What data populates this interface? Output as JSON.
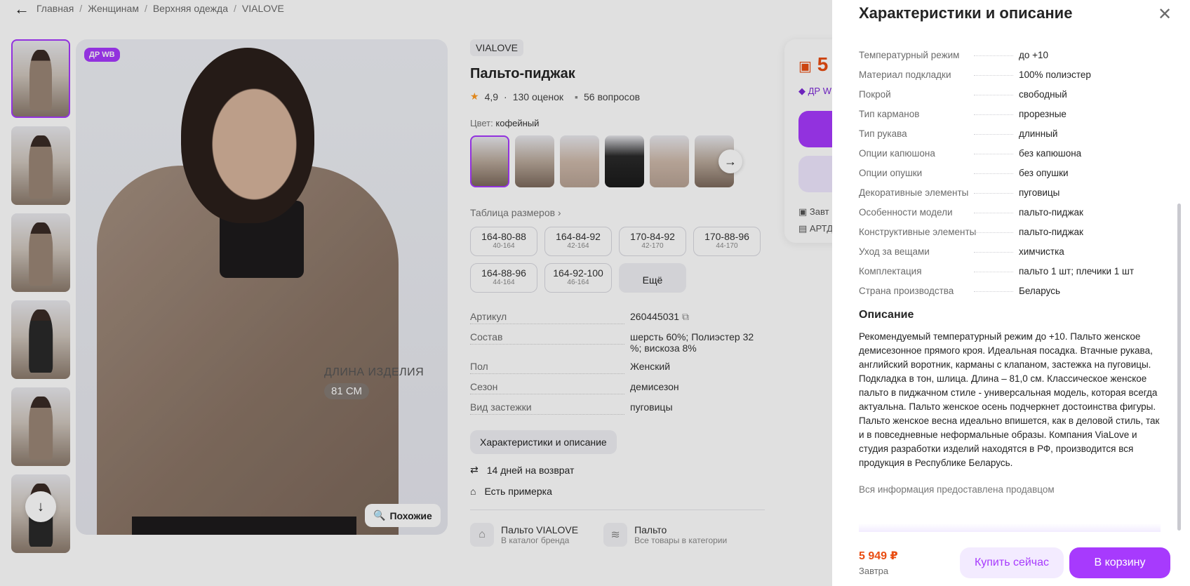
{
  "breadcrumb": {
    "items": [
      "Главная",
      "Женщинам",
      "Верхняя одежда",
      "VIALOVE"
    ],
    "separator": "/"
  },
  "gallery": {
    "badge": "ДР WB",
    "length_label": "ДЛИНА ИЗДЕЛИЯ",
    "length_value": "81 СМ",
    "similar_label": "Похожие"
  },
  "product": {
    "brand": "VIALOVE",
    "title": "Пальто-пиджак",
    "rating": "4,9",
    "rating_sep": "·",
    "reviews": "130 оценок",
    "questions": "56 вопросов",
    "color_label": "Цвет:",
    "color_value": "кофейный",
    "size_table": "Таблица размеров",
    "sizes": [
      {
        "main": "164-80-88",
        "sub": "40-164"
      },
      {
        "main": "164-84-92",
        "sub": "42-164"
      },
      {
        "main": "170-84-92",
        "sub": "42-170"
      },
      {
        "main": "170-88-96",
        "sub": "44-170"
      },
      {
        "main": "164-88-96",
        "sub": "44-164"
      },
      {
        "main": "164-92-100",
        "sub": "46-164"
      }
    ],
    "more_sizes": "Ещё",
    "params": [
      {
        "k": "Артикул",
        "v": "260445031"
      },
      {
        "k": "Состав",
        "v": "шерсть 60%; Полиэстер 32 %; вискоза 8%"
      },
      {
        "k": "Пол",
        "v": "Женский"
      },
      {
        "k": "Сезон",
        "v": "демисезон"
      },
      {
        "k": "Вид застежки",
        "v": "пуговицы"
      }
    ],
    "char_button": "Характеристики и описание",
    "returns": "14 дней на возврат",
    "fitting": "Есть примерка",
    "brand_link": {
      "title": "Пальто VIALOVE",
      "sub": "В каталог бренда"
    },
    "category_link": {
      "title": "Пальто",
      "sub": "Все товары в категории"
    }
  },
  "price_card": {
    "price_partial": "5",
    "tag_partial": "ДР W",
    "delivery_partial": "Завт",
    "pickup_partial": "АРТД"
  },
  "panel": {
    "title": "Характеристики и описание",
    "specs": [
      {
        "k": "Температурный режим",
        "v": "до +10"
      },
      {
        "k": "Материал подкладки",
        "v": "100% полиэстер"
      },
      {
        "k": "Покрой",
        "v": "свободный"
      },
      {
        "k": "Тип карманов",
        "v": "прорезные"
      },
      {
        "k": "Тип рукава",
        "v": "длинный"
      },
      {
        "k": "Опции капюшона",
        "v": "без капюшона"
      },
      {
        "k": "Опции опушки",
        "v": "без опушки"
      },
      {
        "k": "Декоративные элементы",
        "v": "пуговицы"
      },
      {
        "k": "Особенности модели",
        "v": "пальто-пиджак"
      },
      {
        "k": "Конструктивные элементы",
        "v": "пальто-пиджак"
      },
      {
        "k": "Уход за вещами",
        "v": "химчистка"
      },
      {
        "k": "Комплектация",
        "v": "пальто 1 шт; плечики 1 шт"
      },
      {
        "k": "Страна производства",
        "v": "Беларусь"
      }
    ],
    "description_title": "Описание",
    "description": "Рекомендуемый температурный режим до +10. Пальто женское демисезонное прямого кроя. Идеальная посадка. Втачные рукава, английский воротник, карманы с клапаном, застежка на пуговицы. Подкладка в тон, шлица. Длина – 81,0 см. Классическое женское пальто в пиджачном стиле - универсальная модель, которая всегда актуальна. Пальто женское осень подчеркнет достоинства фигуры. Пальто женское весна идеально впишется, как в деловой стиль, так и в повседневные неформальные образы. Компания ViaLove и студия разработки изделий находятся в РФ, производится вся продукция в Республике Беларусь.",
    "seller_note": "Вся информация предоставлена продавцом",
    "footer": {
      "price": "5 949 ₽",
      "date": "Завтра",
      "buy_now": "Купить сейчас",
      "to_cart": "В корзину"
    }
  },
  "colors": {
    "accent": "#a73afd",
    "price": "#e94d12"
  }
}
